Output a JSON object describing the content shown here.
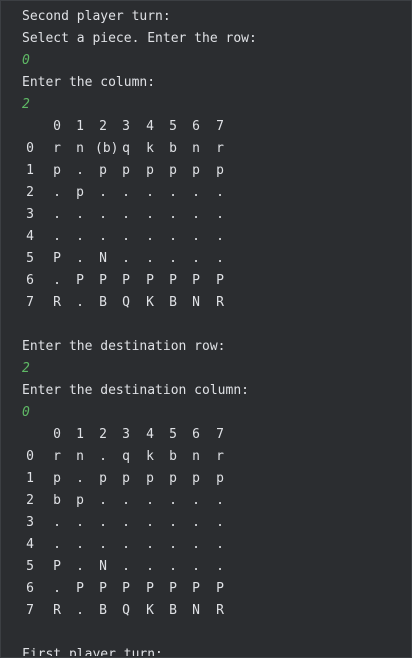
{
  "header": {
    "turn": "Second player turn:",
    "select_prompt": "Select a piece. Enter the row:",
    "row_input": "0",
    "col_prompt": "Enter the column:",
    "col_input": "2"
  },
  "board1": {
    "col_headers": [
      "0",
      "1",
      "2",
      "3",
      "4",
      "5",
      "6",
      "7"
    ],
    "rows": [
      {
        "label": "0",
        "cells": [
          "r",
          "n",
          "(b)",
          "q",
          "k",
          "b",
          "n",
          "r"
        ]
      },
      {
        "label": "1",
        "cells": [
          "p",
          ".",
          "p",
          "p",
          "p",
          "p",
          "p",
          "p"
        ]
      },
      {
        "label": "2",
        "cells": [
          ".",
          "p",
          ".",
          ".",
          ".",
          ".",
          ".",
          "."
        ]
      },
      {
        "label": "3",
        "cells": [
          ".",
          ".",
          ".",
          ".",
          ".",
          ".",
          ".",
          "."
        ]
      },
      {
        "label": "4",
        "cells": [
          ".",
          ".",
          ".",
          ".",
          ".",
          ".",
          ".",
          "."
        ]
      },
      {
        "label": "5",
        "cells": [
          "P",
          ".",
          "N",
          ".",
          ".",
          ".",
          ".",
          "."
        ]
      },
      {
        "label": "6",
        "cells": [
          ".",
          "P",
          "P",
          "P",
          "P",
          "P",
          "P",
          "P"
        ]
      },
      {
        "label": "7",
        "cells": [
          "R",
          ".",
          "B",
          "Q",
          "K",
          "B",
          "N",
          "R"
        ]
      }
    ]
  },
  "destination": {
    "row_prompt": "Enter the destination row:",
    "row_input": "2",
    "col_prompt": "Enter the destination column:",
    "col_input": "0"
  },
  "board2": {
    "col_headers": [
      "0",
      "1",
      "2",
      "3",
      "4",
      "5",
      "6",
      "7"
    ],
    "rows": [
      {
        "label": "0",
        "cells": [
          "r",
          "n",
          ".",
          "q",
          "k",
          "b",
          "n",
          "r"
        ]
      },
      {
        "label": "1",
        "cells": [
          "p",
          ".",
          "p",
          "p",
          "p",
          "p",
          "p",
          "p"
        ]
      },
      {
        "label": "2",
        "cells": [
          "b",
          "p",
          ".",
          ".",
          ".",
          ".",
          ".",
          "."
        ]
      },
      {
        "label": "3",
        "cells": [
          ".",
          ".",
          ".",
          ".",
          ".",
          ".",
          ".",
          "."
        ]
      },
      {
        "label": "4",
        "cells": [
          ".",
          ".",
          ".",
          ".",
          ".",
          ".",
          ".",
          "."
        ]
      },
      {
        "label": "5",
        "cells": [
          "P",
          ".",
          "N",
          ".",
          ".",
          ".",
          ".",
          "."
        ]
      },
      {
        "label": "6",
        "cells": [
          ".",
          "P",
          "P",
          "P",
          "P",
          "P",
          "P",
          "P"
        ]
      },
      {
        "label": "7",
        "cells": [
          "R",
          ".",
          "B",
          "Q",
          "K",
          "B",
          "N",
          "R"
        ]
      }
    ]
  },
  "footer": {
    "next_turn": "First player turn:"
  }
}
